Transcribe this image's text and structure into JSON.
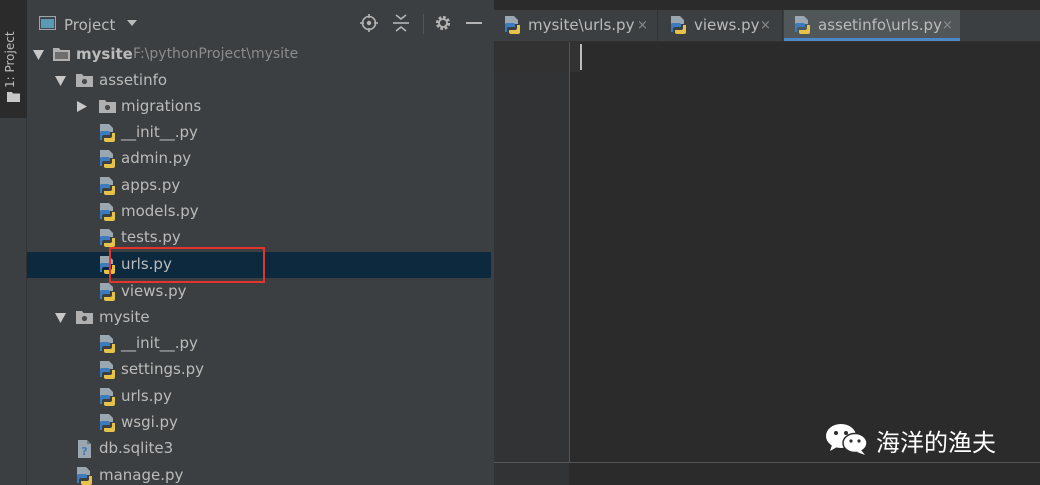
{
  "tool_stripe": {
    "label": "1: Project"
  },
  "panel": {
    "title": "Project",
    "tree": [
      {
        "label": "mysite",
        "path": "F:\\pythonProject\\mysite",
        "type": "root",
        "expanded": true
      },
      {
        "label": "assetinfo",
        "type": "package",
        "expanded": true
      },
      {
        "label": "migrations",
        "type": "package",
        "expanded": false
      },
      {
        "label": "__init__.py",
        "type": "python"
      },
      {
        "label": "admin.py",
        "type": "python"
      },
      {
        "label": "apps.py",
        "type": "python"
      },
      {
        "label": "models.py",
        "type": "python"
      },
      {
        "label": "tests.py",
        "type": "python"
      },
      {
        "label": "urls.py",
        "type": "python",
        "selected": true
      },
      {
        "label": "views.py",
        "type": "python"
      },
      {
        "label": "mysite",
        "type": "package",
        "expanded": true
      },
      {
        "label": "__init__.py",
        "type": "python"
      },
      {
        "label": "settings.py",
        "type": "python"
      },
      {
        "label": "urls.py",
        "type": "python"
      },
      {
        "label": "wsgi.py",
        "type": "python"
      },
      {
        "label": "db.sqlite3",
        "type": "database"
      },
      {
        "label": "manage.py",
        "type": "python"
      }
    ]
  },
  "editor": {
    "tabs": [
      {
        "label": "mysite\\urls.py",
        "active": false
      },
      {
        "label": "views.py",
        "active": false
      },
      {
        "label": "assetinfo\\urls.py",
        "active": true
      }
    ],
    "close_glyph": "×"
  },
  "watermark": {
    "text": "海洋的渔夫",
    "logo": "wechat-logo-icon"
  },
  "colors": {
    "selection": "#0d293e",
    "highlight_box": "#e0342c",
    "active_tab_underline": "#4a88c7"
  }
}
